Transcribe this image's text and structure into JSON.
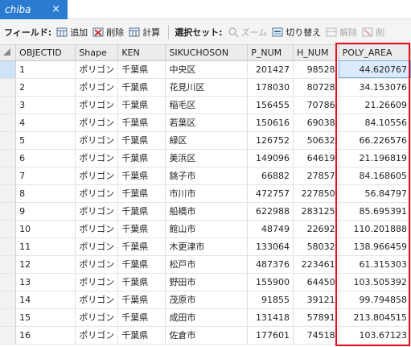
{
  "tab": {
    "title": "chiba",
    "close_glyph": "×"
  },
  "toolbar": {
    "field_label": "フィールド:",
    "add_label": "追加",
    "delete_label": "削除",
    "calc_label": "計算",
    "selection_label": "選択セット:",
    "zoom_label": "ズーム",
    "switch_label": "切り替え",
    "clear_label": "解除",
    "delete2_label": "削"
  },
  "table": {
    "columns": [
      "OBJECTID",
      "Shape",
      "KEN",
      "SIKUCHOSON",
      "P_NUM",
      "H_NUM",
      "POLY_AREA"
    ],
    "rows": [
      [
        "1",
        "ポリゴン",
        "千葉県",
        "中央区",
        "201427",
        "98528",
        "44.620767"
      ],
      [
        "2",
        "ポリゴン",
        "千葉県",
        "花見川区",
        "178030",
        "80728",
        "34.153076"
      ],
      [
        "3",
        "ポリゴン",
        "千葉県",
        "稲毛区",
        "156455",
        "70786",
        "21.26609"
      ],
      [
        "4",
        "ポリゴン",
        "千葉県",
        "若葉区",
        "150616",
        "69038",
        "84.10556"
      ],
      [
        "5",
        "ポリゴン",
        "千葉県",
        "緑区",
        "126752",
        "50632",
        "66.226576"
      ],
      [
        "6",
        "ポリゴン",
        "千葉県",
        "美浜区",
        "149096",
        "64619",
        "21.196819"
      ],
      [
        "7",
        "ポリゴン",
        "千葉県",
        "銚子市",
        "66882",
        "27857",
        "84.168605"
      ],
      [
        "8",
        "ポリゴン",
        "千葉県",
        "市川市",
        "472757",
        "227850",
        "56.84797"
      ],
      [
        "9",
        "ポリゴン",
        "千葉県",
        "船橋市",
        "622988",
        "283125",
        "85.695391"
      ],
      [
        "10",
        "ポリゴン",
        "千葉県",
        "館山市",
        "48749",
        "22692",
        "110.201888"
      ],
      [
        "11",
        "ポリゴン",
        "千葉県",
        "木更津市",
        "133064",
        "58032",
        "138.966459"
      ],
      [
        "12",
        "ポリゴン",
        "千葉県",
        "松戸市",
        "487376",
        "223461",
        "61.315303"
      ],
      [
        "13",
        "ポリゴン",
        "千葉県",
        "野田市",
        "155900",
        "64450",
        "103.505392"
      ],
      [
        "14",
        "ポリゴン",
        "千葉県",
        "茂原市",
        "91855",
        "39121",
        "99.794858"
      ],
      [
        "15",
        "ポリゴン",
        "千葉県",
        "成田市",
        "131418",
        "57891",
        "213.804515"
      ],
      [
        "16",
        "ポリゴン",
        "千葉県",
        "佐倉市",
        "177601",
        "74518",
        "103.67123"
      ]
    ]
  },
  "colors": {
    "tab_bg": "#2b7bd1",
    "highlight_box": "#e0141e",
    "selected_cell": "#dcebfb"
  }
}
